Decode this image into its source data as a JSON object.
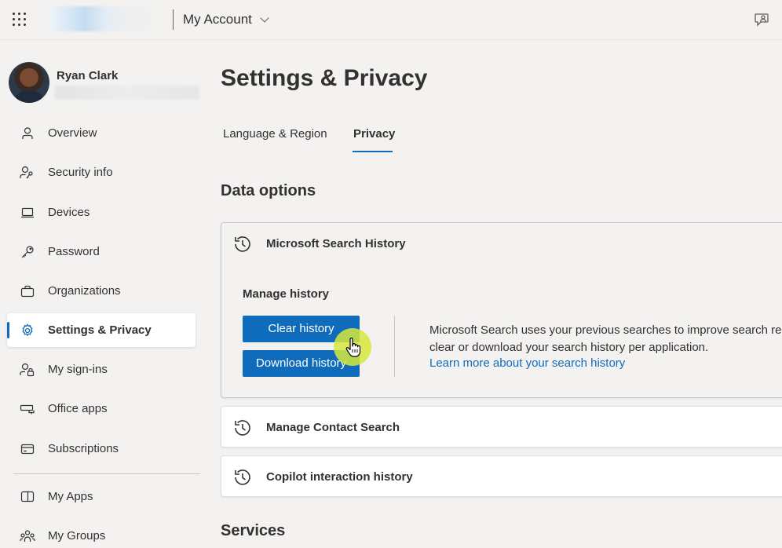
{
  "header": {
    "app_title": "My Account"
  },
  "user": {
    "name": "Ryan Clark"
  },
  "sidebar": {
    "items": [
      {
        "label": "Overview",
        "icon": "person-icon"
      },
      {
        "label": "Security info",
        "icon": "person-key-icon"
      },
      {
        "label": "Devices",
        "icon": "laptop-icon"
      },
      {
        "label": "Password",
        "icon": "key-icon"
      },
      {
        "label": "Organizations",
        "icon": "briefcase-icon"
      },
      {
        "label": "Settings & Privacy",
        "icon": "gear-icon",
        "active": true
      },
      {
        "label": "My sign-ins",
        "icon": "person-lock-icon"
      },
      {
        "label": "Office apps",
        "icon": "office-apps-icon"
      },
      {
        "label": "Subscriptions",
        "icon": "card-icon"
      },
      {
        "label": "My Apps",
        "icon": "apps-icon"
      },
      {
        "label": "My Groups",
        "icon": "people-icon"
      }
    ]
  },
  "main": {
    "title": "Settings & Privacy",
    "tabs": [
      {
        "label": "Language & Region",
        "selected": false
      },
      {
        "label": "Privacy",
        "selected": true
      }
    ],
    "data_options_title": "Data options",
    "cards": [
      {
        "title": "Microsoft Search History",
        "expanded": true,
        "manage_label": "Manage history",
        "clear_button": "Clear history",
        "download_button": "Download history",
        "description_line1": "Microsoft Search uses your previous searches to improve search res",
        "description_line2": "clear or download your search history per application.",
        "learn_more": "Learn more about your search history"
      },
      {
        "title": "Manage Contact Search",
        "expanded": false
      },
      {
        "title": "Copilot interaction history",
        "expanded": false
      }
    ],
    "services_title": "Services"
  },
  "colors": {
    "accent": "#0f6cbd",
    "background": "#f3f2f1",
    "card": "#ffffff",
    "cursor_highlight": "#d6e83c"
  }
}
